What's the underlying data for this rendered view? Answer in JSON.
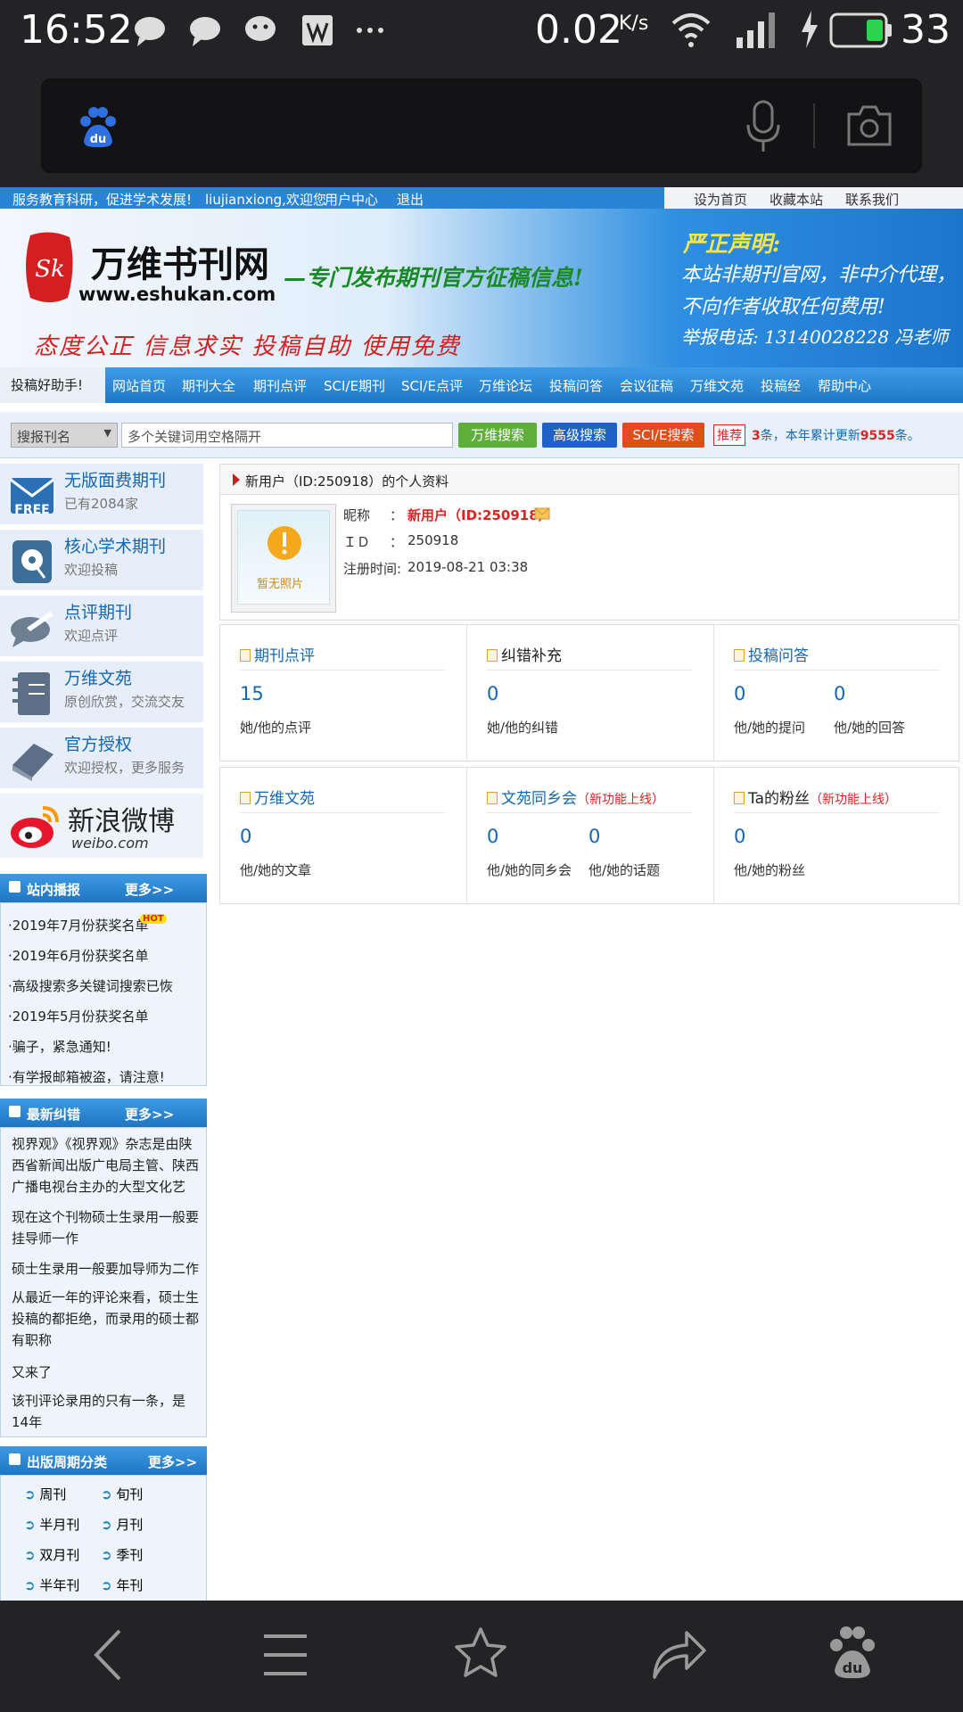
{
  "status": {
    "time": "16:52",
    "speed": "0.02",
    "speed_unit": "K/s",
    "battery": "33"
  },
  "browser": {
    "search_placeholder": ""
  },
  "topline": {
    "slogan": "服务教育科研，促进学术发展!",
    "user": "liujianxiong,欢迎您",
    "user_center": "用户中心",
    "logout": "退出",
    "set_home": "设为首页",
    "bookmark": "收藏本站",
    "contact": "联系我们"
  },
  "banner": {
    "logo_cn": "万维书刊网",
    "logo_url": "www.eshukan.com",
    "tagline": "—专门发布期刊官方征稿信息!",
    "motto": "态度公正 信息求实 投稿自助 使用免费",
    "notice_title": "严正声明:",
    "notice_line1": "本站非期刊官网，非中介代理，",
    "notice_line2": "不向作者收取任何费用!",
    "notice_line3": "举报电话: 13140028228 冯老师"
  },
  "nav": {
    "help": "投稿好助手!",
    "items": [
      "网站首页",
      "期刊大全",
      "期刊点评",
      "SCI/E期刊",
      "SCI/E点评",
      "万维论坛",
      "投稿问答",
      "会议征稿",
      "万维文苑",
      "投稿经",
      "帮助中心"
    ]
  },
  "search": {
    "select": "搜报刊名",
    "placeholder": "多个关键词用空格隔开",
    "btn1": "万维搜索",
    "btn2": "高级搜索",
    "btn3": "SCI/E搜索",
    "tag": "推荐",
    "info_a": "3",
    "info_b": "条，本年累计更新",
    "info_c": "9555",
    "info_d": "条。"
  },
  "sidebar": {
    "cats": [
      {
        "t": "无版面费期刊",
        "s": "已有2084家"
      },
      {
        "t": "核心学术期刊",
        "s": "欢迎投稿"
      },
      {
        "t": "点评期刊",
        "s": "欢迎点评"
      },
      {
        "t": "万维文苑",
        "s": "原创欣赏，交流交友"
      },
      {
        "t": "官方授权",
        "s": "欢迎授权，更多服务"
      }
    ],
    "weibo_cn": "新浪微博",
    "weibo_en": "weibo.com",
    "news_title": "站内播报",
    "more": "更多>>",
    "hot": "HOT",
    "news": [
      "·2019年7月份获奖名单",
      "·2019年6月份获奖名单",
      "·高级搜索多关键词搜索已恢",
      "·2019年5月份获奖名单",
      "·骗子，紧急通知!",
      "·有学报邮箱被盗，请注意!"
    ],
    "corr_title": "最新纠错",
    "corr": [
      "视界观》《视界观》杂志是由陕西省新闻出版广电局主管、陕西广播电视台主办的大型文化艺",
      "现在这个刊物硕士生录用一般要挂导师一作",
      "硕士生录用一般要加导师为二作",
      "从最近一年的评论来看，硕士生投稿的都拒绝，而录用的硕士都有职称",
      "又来了",
      "该刊评论录用的只有一条，是14年"
    ],
    "period_title": "出版周期分类",
    "period": [
      "周刊",
      "旬刊",
      "半月刊",
      "月刊",
      "双月刊",
      "季刊",
      "半年刊",
      "年刊"
    ]
  },
  "profile": {
    "title": "新用户（ID:250918）的个人资料",
    "photo": "暂无照片",
    "nick_label": "昵称",
    "nick": "新用户（ID:250918）",
    "id_label": "ＩＤ",
    "id": "250918",
    "reg_label": "注册时间:",
    "reg": "2019-08-21 03:38",
    "colon": "："
  },
  "stats": {
    "c1": {
      "h": "期刊点评",
      "n": "15",
      "d": "她/他的点评"
    },
    "c2": {
      "h": "纠错补充",
      "n": "0",
      "d": "她/他的纠错"
    },
    "c3": {
      "h": "投稿问答",
      "n1": "0",
      "d1": "他/她的提问",
      "n2": "0",
      "d2": "他/她的回答"
    },
    "c4": {
      "h": "万维文苑",
      "n": "0",
      "d": "他/她的文章"
    },
    "c5": {
      "h": "文苑同乡会",
      "tag": "（新功能上线）",
      "n1": "0",
      "d1": "他/她的同乡会",
      "n2": "0",
      "d2": "他/她的话题"
    },
    "c6": {
      "h": "Ta的粉丝",
      "tag": "（新功能上线）",
      "n": "0",
      "d": "他/她的粉丝"
    }
  },
  "colors": {
    "accent": "#1467b4",
    "nav": "#1f78c7",
    "red": "#d22"
  }
}
